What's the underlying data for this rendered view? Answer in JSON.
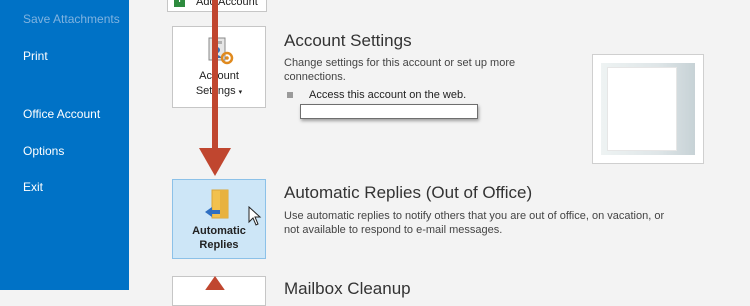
{
  "sidebar": {
    "items": [
      {
        "label": "Save Attachments",
        "disabled": true
      },
      {
        "label": "Print"
      },
      {
        "label": "Office Account"
      },
      {
        "label": "Options"
      },
      {
        "label": "Exit"
      }
    ]
  },
  "toolbar": {
    "add_account_label": "Add Account"
  },
  "account_settings": {
    "tile_label_line1": "Account",
    "tile_label_line2": "Settings",
    "title": "Account Settings",
    "description_line1": "Change settings for this account or set up more",
    "description_line2": "connections.",
    "web_access_label": "Access this account on the web."
  },
  "automatic_replies": {
    "tile_label_line1": "Automatic",
    "tile_label_line2": "Replies",
    "title": "Automatic Replies (Out of Office)",
    "description_line1": "Use automatic replies to notify others that you are out of office, on vacation, or",
    "description_line2": "not available to respond to e-mail messages."
  },
  "mailbox_cleanup": {
    "title": "Mailbox Cleanup"
  },
  "colors": {
    "sidebar_bg": "#0072c6",
    "annotation_arrow": "#c0462f",
    "selected_tile_bg": "#cde6f7"
  },
  "icons": {
    "account_settings": "account-gear-icon",
    "automatic_replies": "auto-reply-arrow-icon",
    "add_account": "plus-icon"
  }
}
